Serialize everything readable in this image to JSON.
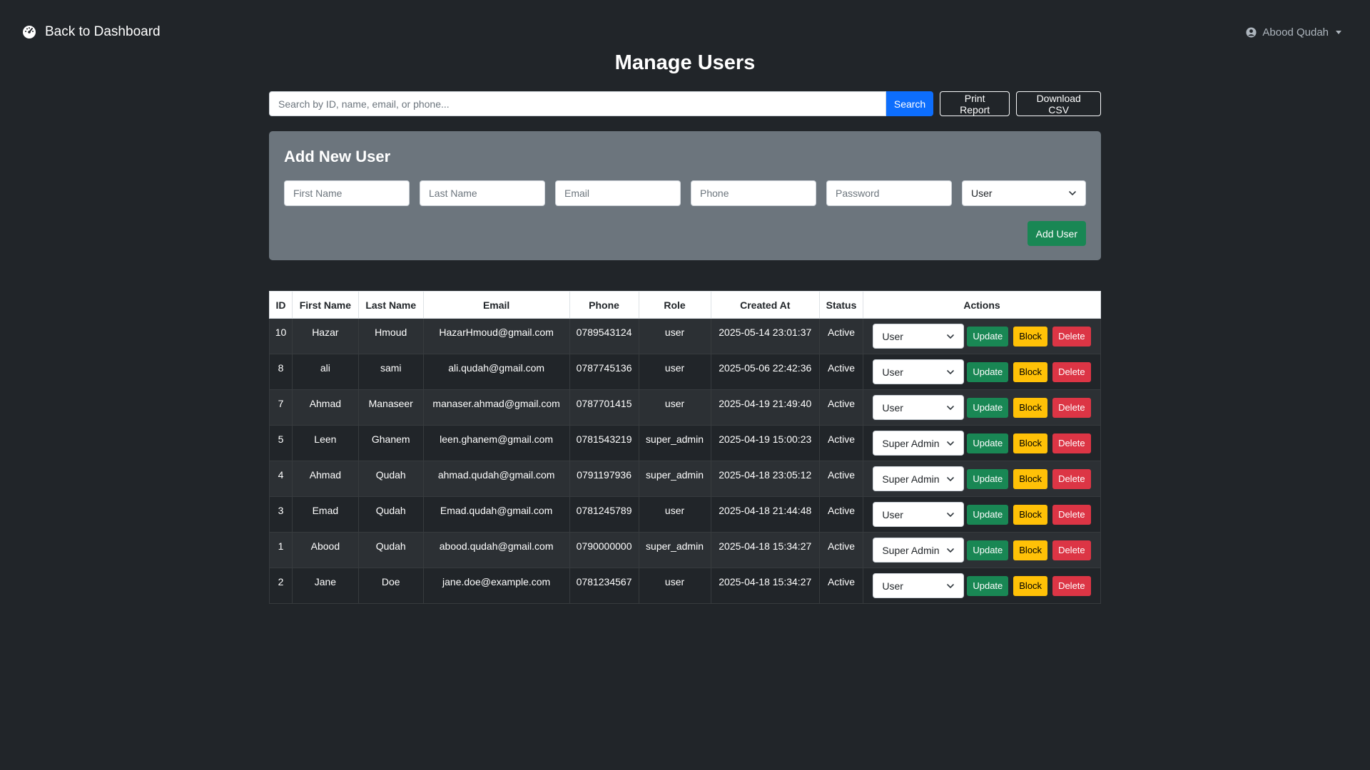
{
  "header": {
    "back_label": "Back to Dashboard",
    "user_name": "Abood Qudah"
  },
  "page": {
    "title": "Manage Users"
  },
  "search": {
    "placeholder": "Search by ID, name, email, or phone...",
    "button_label": "Search",
    "print_label": "Print Report",
    "csv_label": "Download CSV"
  },
  "add_user": {
    "title": "Add New User",
    "first_name_placeholder": "First Name",
    "last_name_placeholder": "Last Name",
    "email_placeholder": "Email",
    "phone_placeholder": "Phone",
    "password_placeholder": "Password",
    "role_selected": "User",
    "button_label": "Add User"
  },
  "table": {
    "columns": [
      "ID",
      "First Name",
      "Last Name",
      "Email",
      "Phone",
      "Role",
      "Created At",
      "Status",
      "Actions"
    ],
    "update_label": "Update",
    "block_label": "Block",
    "delete_label": "Delete",
    "rows": [
      {
        "id": "10",
        "first": "Hazar",
        "last": "Hmoud",
        "email": "HazarHmoud@gmail.com",
        "phone": "0789543124",
        "role": "user",
        "created": "2025-05-14 23:01:37",
        "status": "Active",
        "role_select": "User"
      },
      {
        "id": "8",
        "first": "ali",
        "last": "sami",
        "email": "ali.qudah@gmail.com",
        "phone": "0787745136",
        "role": "user",
        "created": "2025-05-06 22:42:36",
        "status": "Active",
        "role_select": "User"
      },
      {
        "id": "7",
        "first": "Ahmad",
        "last": "Manaseer",
        "email": "manaser.ahmad@gmail.com",
        "phone": "0787701415",
        "role": "user",
        "created": "2025-04-19 21:49:40",
        "status": "Active",
        "role_select": "User"
      },
      {
        "id": "5",
        "first": "Leen",
        "last": "Ghanem",
        "email": "leen.ghanem@gmail.com",
        "phone": "0781543219",
        "role": "super_admin",
        "created": "2025-04-19 15:00:23",
        "status": "Active",
        "role_select": "Super Admin"
      },
      {
        "id": "4",
        "first": "Ahmad",
        "last": "Qudah",
        "email": "ahmad.qudah@gmail.com",
        "phone": "0791197936",
        "role": "super_admin",
        "created": "2025-04-18 23:05:12",
        "status": "Active",
        "role_select": "Super Admin"
      },
      {
        "id": "3",
        "first": "Emad",
        "last": "Qudah",
        "email": "Emad.qudah@gmail.com",
        "phone": "0781245789",
        "role": "user",
        "created": "2025-04-18 21:44:48",
        "status": "Active",
        "role_select": "User"
      },
      {
        "id": "1",
        "first": "Abood",
        "last": "Qudah",
        "email": "abood.qudah@gmail.com",
        "phone": "0790000000",
        "role": "super_admin",
        "created": "2025-04-18 15:34:27",
        "status": "Active",
        "role_select": "Super Admin"
      },
      {
        "id": "2",
        "first": "Jane",
        "last": "Doe",
        "email": "jane.doe@example.com",
        "phone": "0781234567",
        "role": "user",
        "created": "2025-04-18 15:34:27",
        "status": "Active",
        "role_select": "User"
      }
    ]
  },
  "colors": {
    "background": "#212529",
    "primary": "#0d6efd",
    "success": "#198754",
    "warning": "#ffc107",
    "danger": "#dc3545",
    "card": "#6c757d"
  },
  "icons": {
    "back": "dashboard-gauge-icon",
    "user": "user-circle-icon",
    "dropdown": "chevron-down-icon"
  }
}
